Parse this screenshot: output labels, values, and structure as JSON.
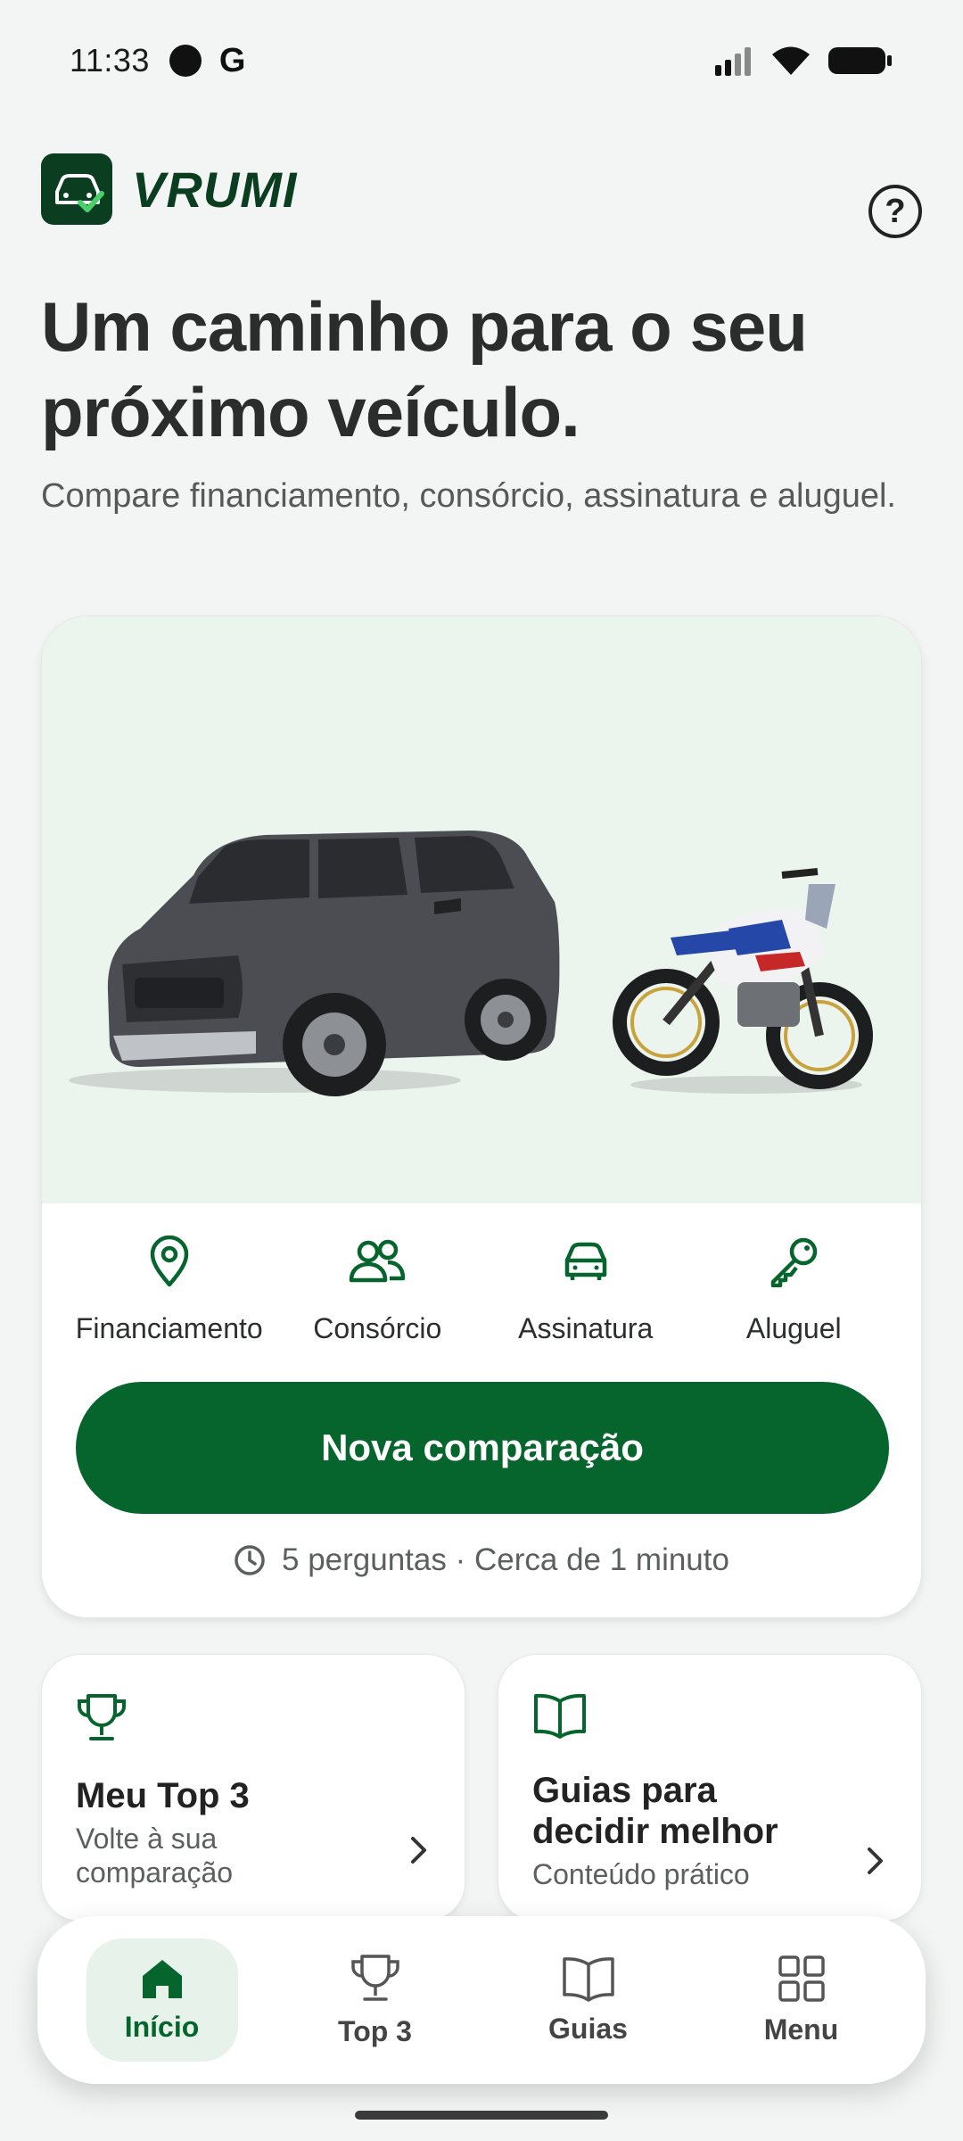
{
  "status": {
    "time": "11:33",
    "g_letter": "G"
  },
  "header": {
    "logo_text": "VRUMI",
    "help_symbol": "?"
  },
  "headline": "Um caminho para o seu próximo veículo.",
  "subline": "Compare financiamento, consórcio, assinatura e aluguel.",
  "hero": {
    "options": [
      {
        "label": "Financiamento",
        "icon": "location-pin-icon"
      },
      {
        "label": "Consórcio",
        "icon": "people-icon"
      },
      {
        "label": "Assinatura",
        "icon": "car-icon"
      },
      {
        "label": "Aluguel",
        "icon": "key-icon"
      }
    ],
    "cta_label": "Nova comparação",
    "cta_meta": "5 perguntas · Cerca de 1 minuto"
  },
  "cards": {
    "top3": {
      "title": "Meu Top 3",
      "subtitle": "Volte à sua comparação",
      "icon": "trophy-icon"
    },
    "guides": {
      "title": "Guias para decidir melhor",
      "subtitle": "Conteúdo prático",
      "icon": "book-icon"
    }
  },
  "nav": [
    {
      "label": "Início",
      "icon": "home-icon",
      "active": true
    },
    {
      "label": "Top 3",
      "icon": "trophy-icon",
      "active": false
    },
    {
      "label": "Guias",
      "icon": "book-icon",
      "active": false
    },
    {
      "label": "Menu",
      "icon": "grid-icon",
      "active": false
    }
  ],
  "colors": {
    "brand_green": "#06652c",
    "dark_green": "#0b3d20",
    "hero_bg": "#ecf4ee"
  }
}
